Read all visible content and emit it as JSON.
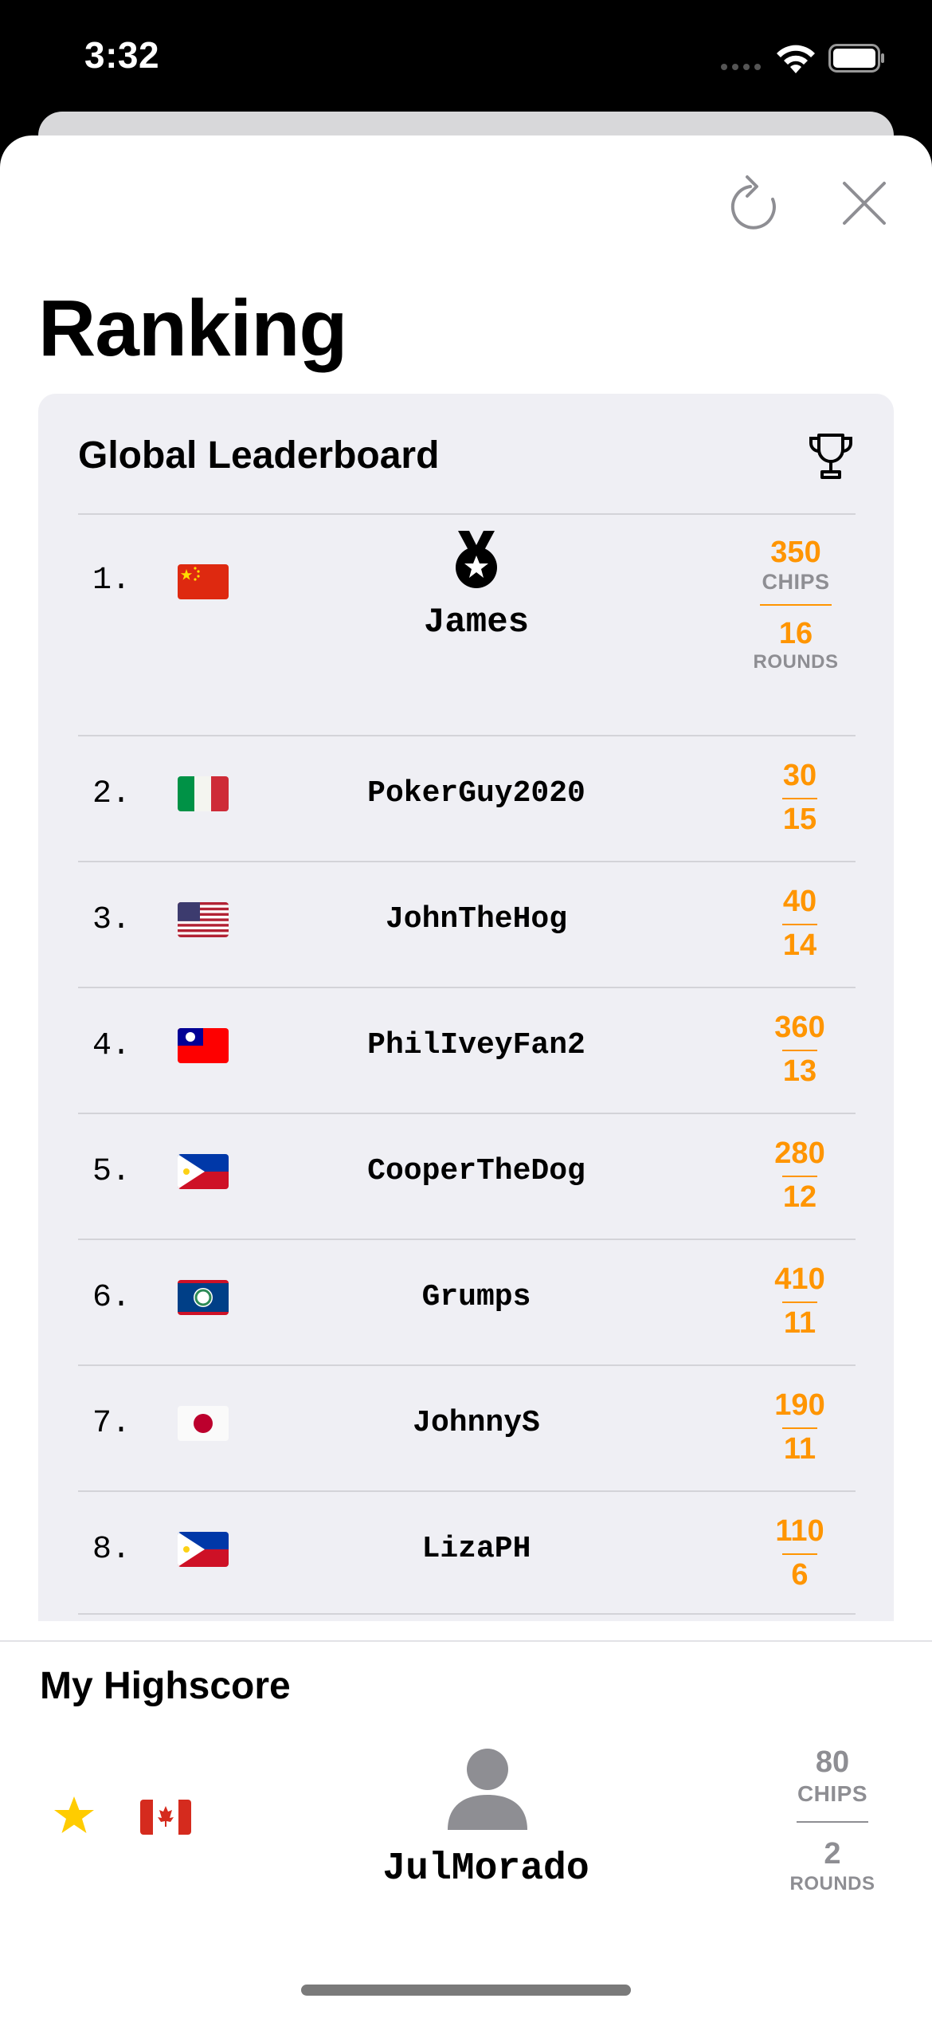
{
  "status": {
    "time": "3:32"
  },
  "page": {
    "title": "Ranking"
  },
  "leaderboard": {
    "title": "Global Leaderboard",
    "top": {
      "rank": "1.",
      "flag": "china",
      "name": "James",
      "chips": "350",
      "chips_label": "CHIPS",
      "rounds": "16",
      "rounds_label": "ROUNDS"
    },
    "rows": [
      {
        "rank": "2.",
        "flag": "italy",
        "name": "PokerGuy2020",
        "chips": "30",
        "rounds": "15"
      },
      {
        "rank": "3.",
        "flag": "usa",
        "name": "JohnTheHog",
        "chips": "40",
        "rounds": "14"
      },
      {
        "rank": "4.",
        "flag": "taiwan",
        "name": "PhilIveyFan2",
        "chips": "360",
        "rounds": "13"
      },
      {
        "rank": "5.",
        "flag": "philippines",
        "name": "CooperTheDog",
        "chips": "280",
        "rounds": "12"
      },
      {
        "rank": "6.",
        "flag": "belize",
        "name": "Grumps",
        "chips": "410",
        "rounds": "11"
      },
      {
        "rank": "7.",
        "flag": "japan",
        "name": "JohnnyS",
        "chips": "190",
        "rounds": "11"
      },
      {
        "rank": "8.",
        "flag": "philippines",
        "name": "LizaPH",
        "chips": "110",
        "rounds": "6"
      }
    ]
  },
  "highscore": {
    "title": "My Highscore",
    "flag": "canada",
    "name": "JulMorado",
    "chips": "80",
    "chips_label": "CHIPS",
    "rounds": "2",
    "rounds_label": "ROUNDS"
  },
  "colors": {
    "accent": "#ff9500",
    "muted": "#8e8e93",
    "card": "#efeff4"
  },
  "icons": [
    "refresh-icon",
    "close-icon",
    "trophy-icon",
    "medal-icon",
    "star-icon",
    "person-icon"
  ]
}
